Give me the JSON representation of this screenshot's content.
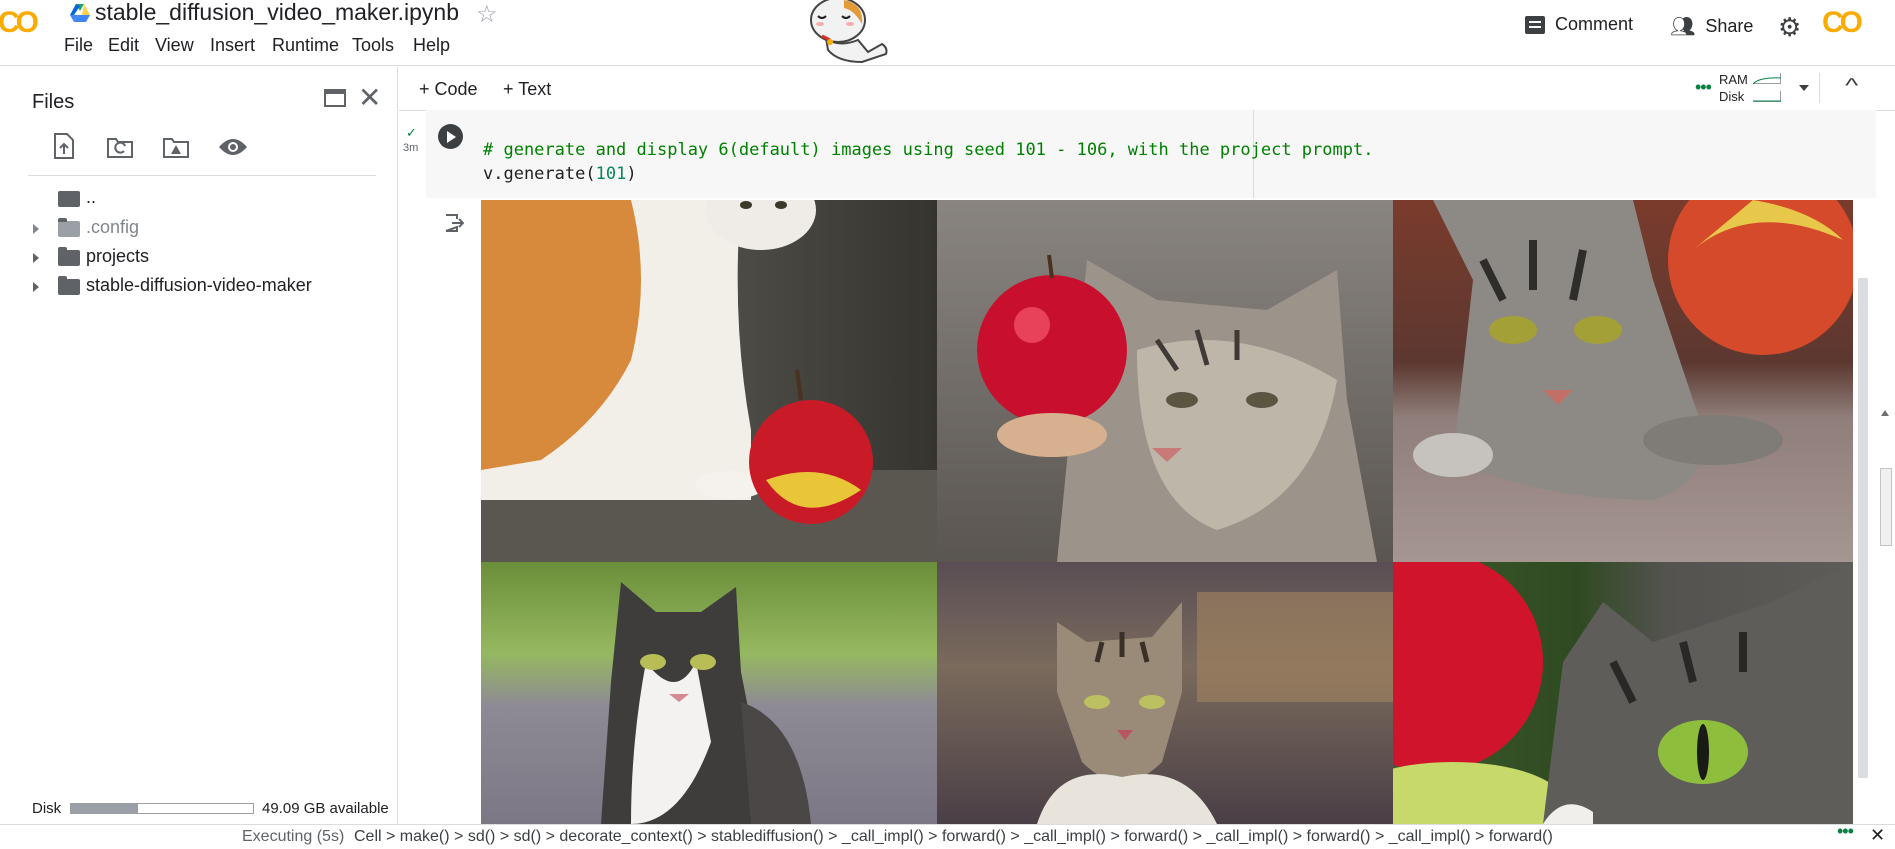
{
  "header": {
    "logo": "CO",
    "title": "stable_diffusion_video_maker.ipynb",
    "menu": [
      "File",
      "Edit",
      "View",
      "Insert",
      "Runtime",
      "Tools",
      "Help"
    ],
    "comment_label": "Comment",
    "share_label": "Share",
    "right_logo": "CO"
  },
  "sidebar": {
    "title": "Files",
    "tree": [
      {
        "label": ".."
      },
      {
        "label": ".config"
      },
      {
        "label": "projects"
      },
      {
        "label": "stable-diffusion-video-maker"
      }
    ],
    "disk_label": "Disk",
    "disk_available": "49.09 GB available",
    "disk_used_fraction": 0.37
  },
  "toolbar": {
    "code_label": "+ Code",
    "text_label": "+ Text",
    "ram_label": "RAM",
    "disk_label": "Disk"
  },
  "cell": {
    "exec_time": "3m",
    "comment_line": "# generate and display 6(default) images using seed 101 - 106, with the project prompt.",
    "code_prefix": "v.generate(",
    "code_arg": "101",
    "code_suffix": ")"
  },
  "status": {
    "executing": "Executing (5s)",
    "trace": "Cell > make() > sd() > sd() > decorate_context() > stablediffusion() > _call_impl() > forward() > _call_impl() > forward() > _call_impl() > forward() > _call_impl() > forward()"
  },
  "colors": {
    "accent_orange": "#f9ab00",
    "code_comment": "#008000",
    "code_number": "#098658",
    "status_green": "#0b8043"
  },
  "output_images": [
    {
      "icon": "cat-apple-image-1"
    },
    {
      "icon": "cat-apple-image-2"
    },
    {
      "icon": "cat-apple-image-3"
    },
    {
      "icon": "cat-apple-image-4"
    },
    {
      "icon": "cat-apple-image-5"
    },
    {
      "icon": "cat-apple-image-6"
    }
  ]
}
